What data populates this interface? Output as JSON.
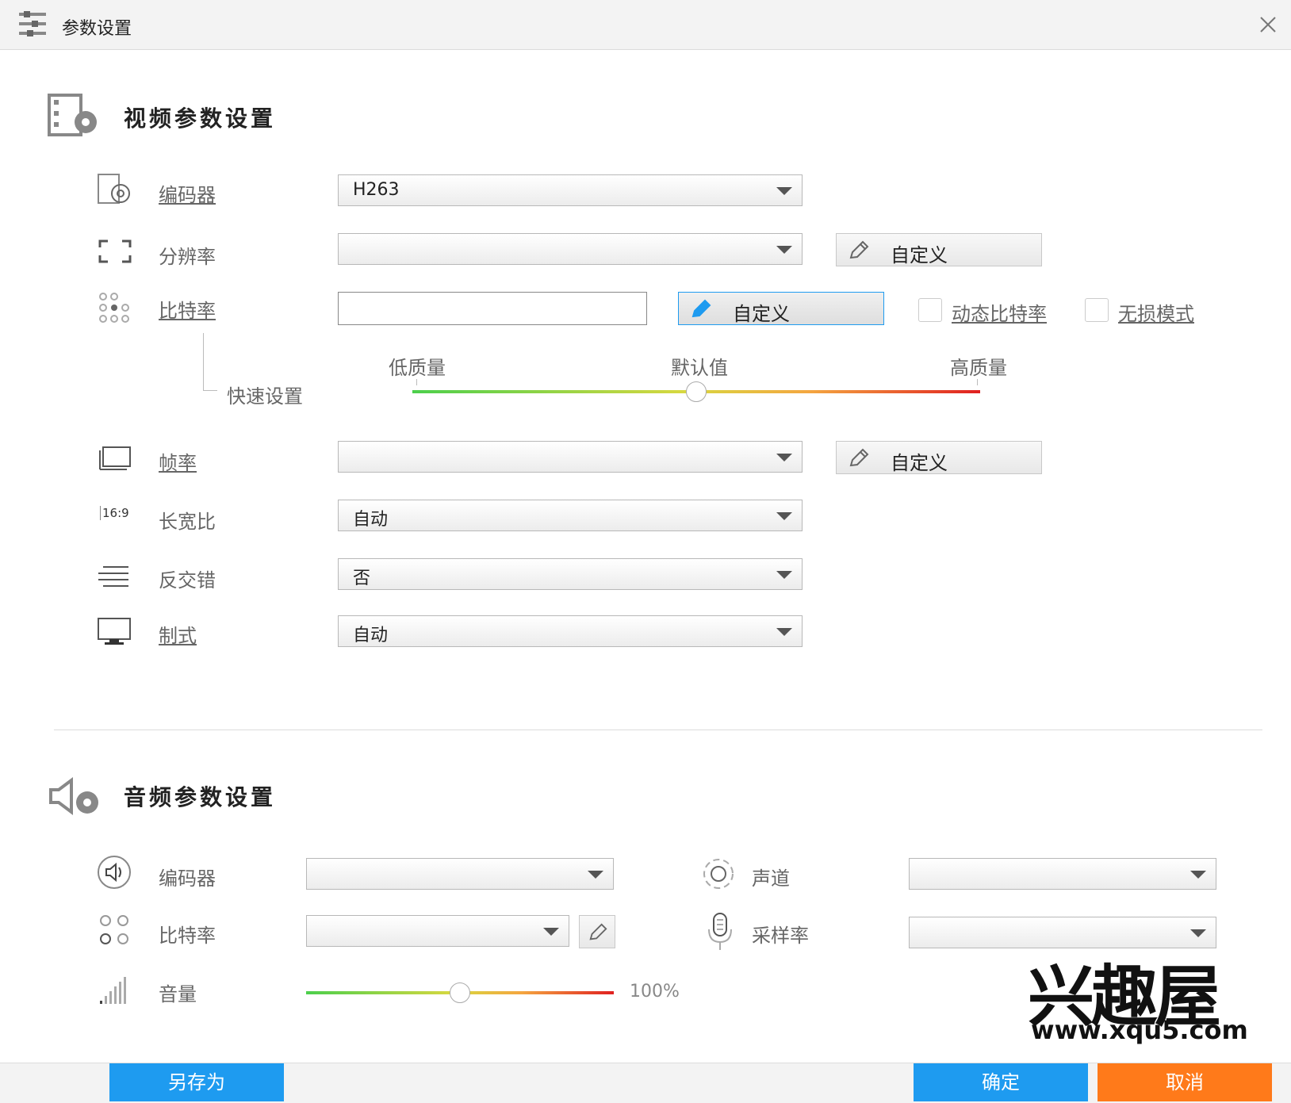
{
  "window": {
    "title": "参数设置"
  },
  "video": {
    "section_title": "视频参数设置",
    "encoder": {
      "label": "编码器",
      "value": "H263"
    },
    "resolution": {
      "label": "分辨率",
      "value": "",
      "custom_label": "自定义"
    },
    "bitrate": {
      "label": "比特率",
      "input_value": "",
      "custom_label": "自定义",
      "dynamic_bitrate_label": "动态比特率",
      "lossless_label": "无损模式",
      "quick_label": "快速设置",
      "slider_low": "低质量",
      "slider_default": "默认值",
      "slider_high": "高质量",
      "slider_position": 0.5
    },
    "framerate": {
      "label": "帧率",
      "value": "",
      "custom_label": "自定义"
    },
    "aspect": {
      "label": "长宽比",
      "value": "自动",
      "icon_text": "16:9"
    },
    "deinterlace": {
      "label": "反交错",
      "value": "否"
    },
    "standard": {
      "label": "制式",
      "value": "自动"
    }
  },
  "audio": {
    "section_title": "音频参数设置",
    "encoder": {
      "label": "编码器",
      "value": ""
    },
    "channel": {
      "label": "声道",
      "value": ""
    },
    "bitrate": {
      "label": "比特率",
      "value": ""
    },
    "samplerate": {
      "label": "采样率",
      "value": ""
    },
    "volume": {
      "label": "音量",
      "value_text": "100%",
      "level": 0.5
    }
  },
  "footer": {
    "save_as": "另存为",
    "ok": "确定",
    "cancel": "取消"
  },
  "watermark": {
    "brand": "兴趣屋",
    "url": "www.xqu5.com"
  },
  "colors": {
    "primary_blue": "#1e9bf0",
    "cancel_orange": "#ff7a1a"
  }
}
